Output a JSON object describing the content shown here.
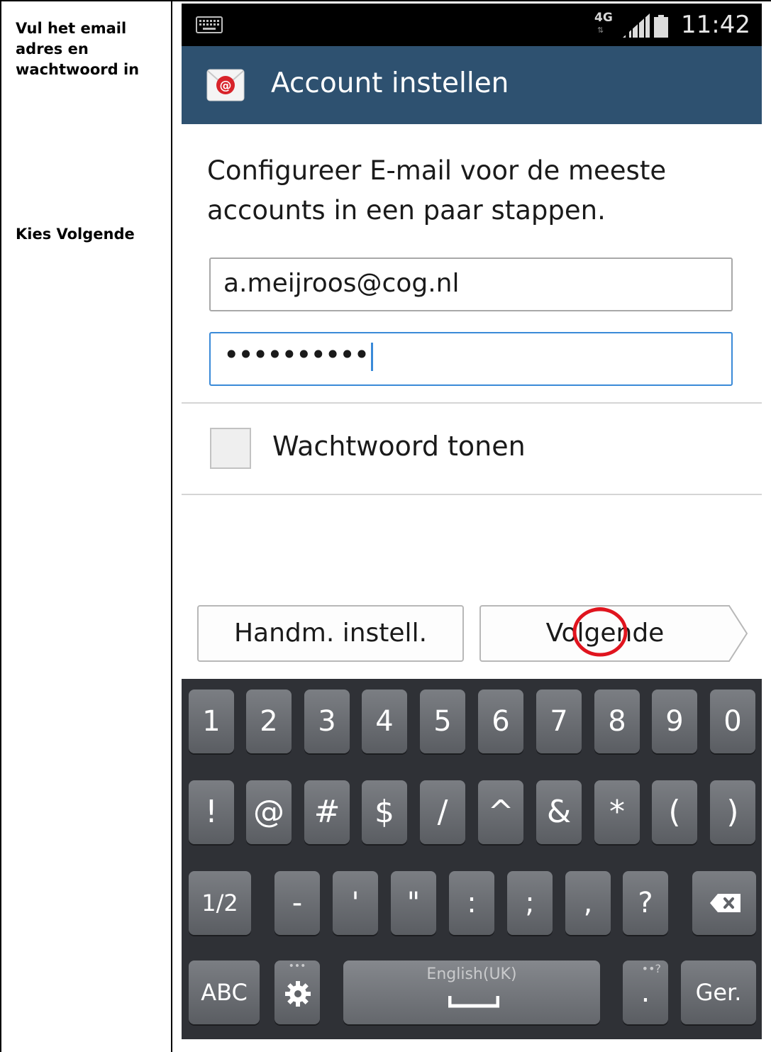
{
  "document": {
    "instruction_1": "Vul het email adres en wachtwoord in",
    "instruction_2": "Kies Volgende"
  },
  "status_bar": {
    "network": "4G",
    "time": "11:42",
    "icons": [
      "keyboard-icon",
      "data-arrows-icon",
      "signal-icon",
      "battery-icon"
    ]
  },
  "action_bar": {
    "app_icon": "email-app-icon",
    "title": "Account instellen"
  },
  "content": {
    "intro": "Configureer E-mail voor de meeste accounts in een paar stappen.",
    "email_value": "a.meijroos@cog.nl",
    "password_value": "••••••••••",
    "show_password_label": "Wachtwoord tonen",
    "show_password_checked": false
  },
  "buttons": {
    "manual": "Handm. instell.",
    "next": "Volgende"
  },
  "keyboard": {
    "row1": [
      "1",
      "2",
      "3",
      "4",
      "5",
      "6",
      "7",
      "8",
      "9",
      "0"
    ],
    "row2": [
      "!",
      "@",
      "#",
      "$",
      "/",
      "^",
      "&",
      "*",
      "(",
      ")"
    ],
    "row3": [
      "1/2",
      "-",
      "'",
      "\"",
      ":",
      ";",
      ",",
      "?"
    ],
    "row4": {
      "abc": "ABC",
      "settings_dots": "•••",
      "space_label": "English(UK)",
      "period": ".",
      "period_hint": "••?",
      "enter": "Ger."
    }
  },
  "colors": {
    "action_bar": "#2e5170",
    "focus": "#3a8ad8",
    "keyboard_bg": "#2f3136",
    "annotation": "#e0141e"
  }
}
